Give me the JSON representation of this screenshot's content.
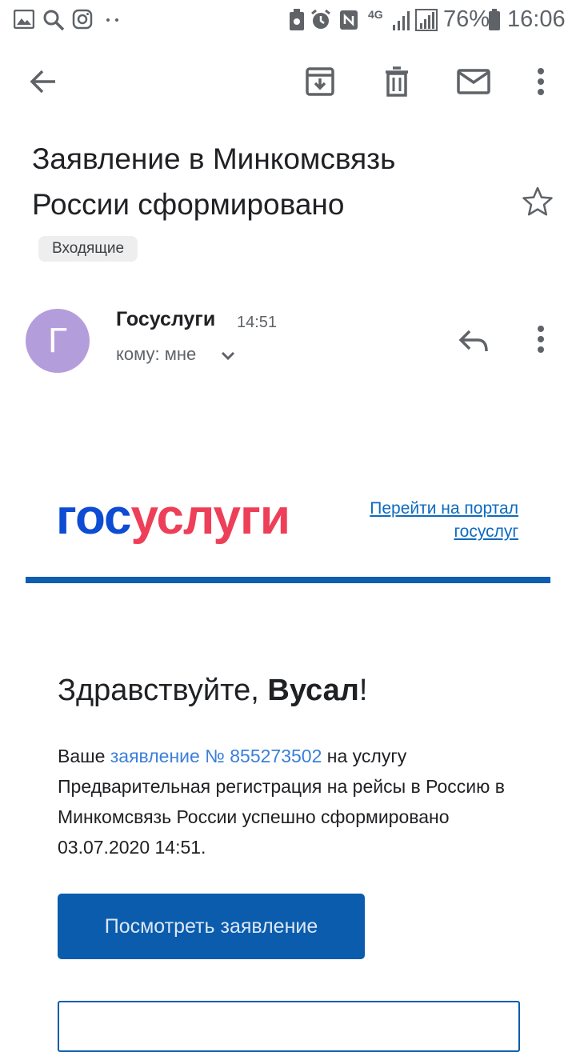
{
  "status_bar": {
    "battery": "76%",
    "time": "16:06",
    "network": "4G",
    "icons": [
      "gallery-icon",
      "search-icon",
      "instagram-icon",
      "dots-icon",
      "battery-saver-icon",
      "alarm-icon",
      "nfc-icon",
      "signal-icon",
      "signal-icon",
      "battery-icon"
    ]
  },
  "toolbar": {
    "icons": [
      "back-arrow-icon",
      "archive-icon",
      "delete-icon",
      "mark-unread-icon",
      "more-vert-icon"
    ]
  },
  "email": {
    "subject_line1": "Заявление в Минкомсвязь",
    "subject_line2": "России сформировано",
    "label": "Входящие",
    "avatar_letter": "Г",
    "avatar_color": "#b39ddb",
    "sender": "Госуслуги",
    "time": "14:51",
    "to": "кому: мне"
  },
  "body": {
    "logo_part1": "гос",
    "logo_part2": "услуги",
    "portal_link_line1": "Перейти на портал",
    "portal_link_line2": "госуслуг",
    "greeting_prefix": "Здравствуйте, ",
    "greeting_name": "Вусал",
    "greeting_suffix": "!",
    "para_prefix": "Ваше ",
    "para_link": "заявление № 855273502",
    "para_rest": " на услугу Предварительная регистрация на рейсы в Россию в Минкомсвязь России успешно сформировано 03.07.2020 14:51.",
    "view_button": "Посмотреть заявление"
  },
  "colors": {
    "accent_blue": "#0b5cad",
    "logo_blue": "#0d4cd3",
    "logo_red": "#ee3f58",
    "link": "#3b7fd9"
  }
}
